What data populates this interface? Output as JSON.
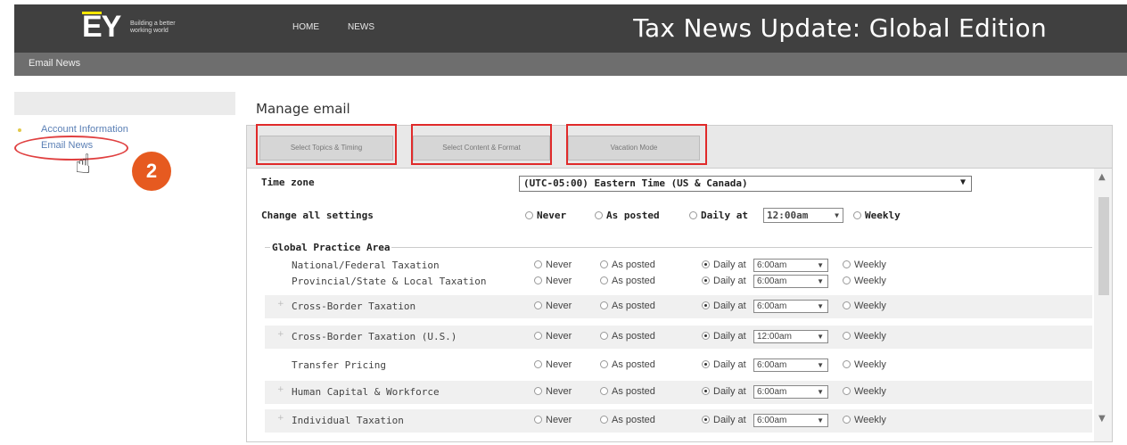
{
  "header": {
    "logo_text": "EY",
    "tagline": "Building a better working world",
    "nav": [
      "HOME",
      "NEWS"
    ],
    "site_title": "Tax News Update: Global Edition",
    "subnav_label": "Email News"
  },
  "sidebar": {
    "items": [
      {
        "label": "Account Information"
      },
      {
        "label": "Email News"
      }
    ],
    "step_badge": "2"
  },
  "main": {
    "title": "Manage email",
    "tabs": [
      {
        "label": "Select Topics & Timing"
      },
      {
        "label": "Select Content & Format"
      },
      {
        "label": "Vacation Mode"
      }
    ],
    "timezone_label": "Time zone",
    "timezone_value": "(UTC-05:00) Eastern Time (US & Canada)",
    "change_all_label": "Change all settings",
    "options": {
      "never": "Never",
      "as_posted": "As posted",
      "daily_at": "Daily at",
      "weekly": "Weekly"
    },
    "change_all_time": "12:00am",
    "group_label": "Global Practice Area",
    "rows": [
      {
        "label": "National/Federal Taxation",
        "time": "6:00am",
        "selected": "daily"
      },
      {
        "label": "Provincial/State & Local Taxation",
        "time": "6:00am",
        "selected": "daily"
      },
      {
        "label": "Cross-Border Taxation",
        "time": "6:00am",
        "selected": "daily"
      },
      {
        "label": "Cross-Border Taxation (U.S.)",
        "time": "12:00am",
        "selected": "daily"
      },
      {
        "label": "Transfer Pricing",
        "time": "6:00am",
        "selected": "daily"
      },
      {
        "label": "Human Capital & Workforce",
        "time": "6:00am",
        "selected": "daily"
      },
      {
        "label": "Individual Taxation",
        "time": "6:00am",
        "selected": "daily"
      }
    ]
  },
  "colors": {
    "topbar": "#404040",
    "subbar": "#6e6e6e",
    "highlight": "#e02a2a",
    "badge": "#e65a20",
    "ey_yellow": "#ffe600"
  }
}
